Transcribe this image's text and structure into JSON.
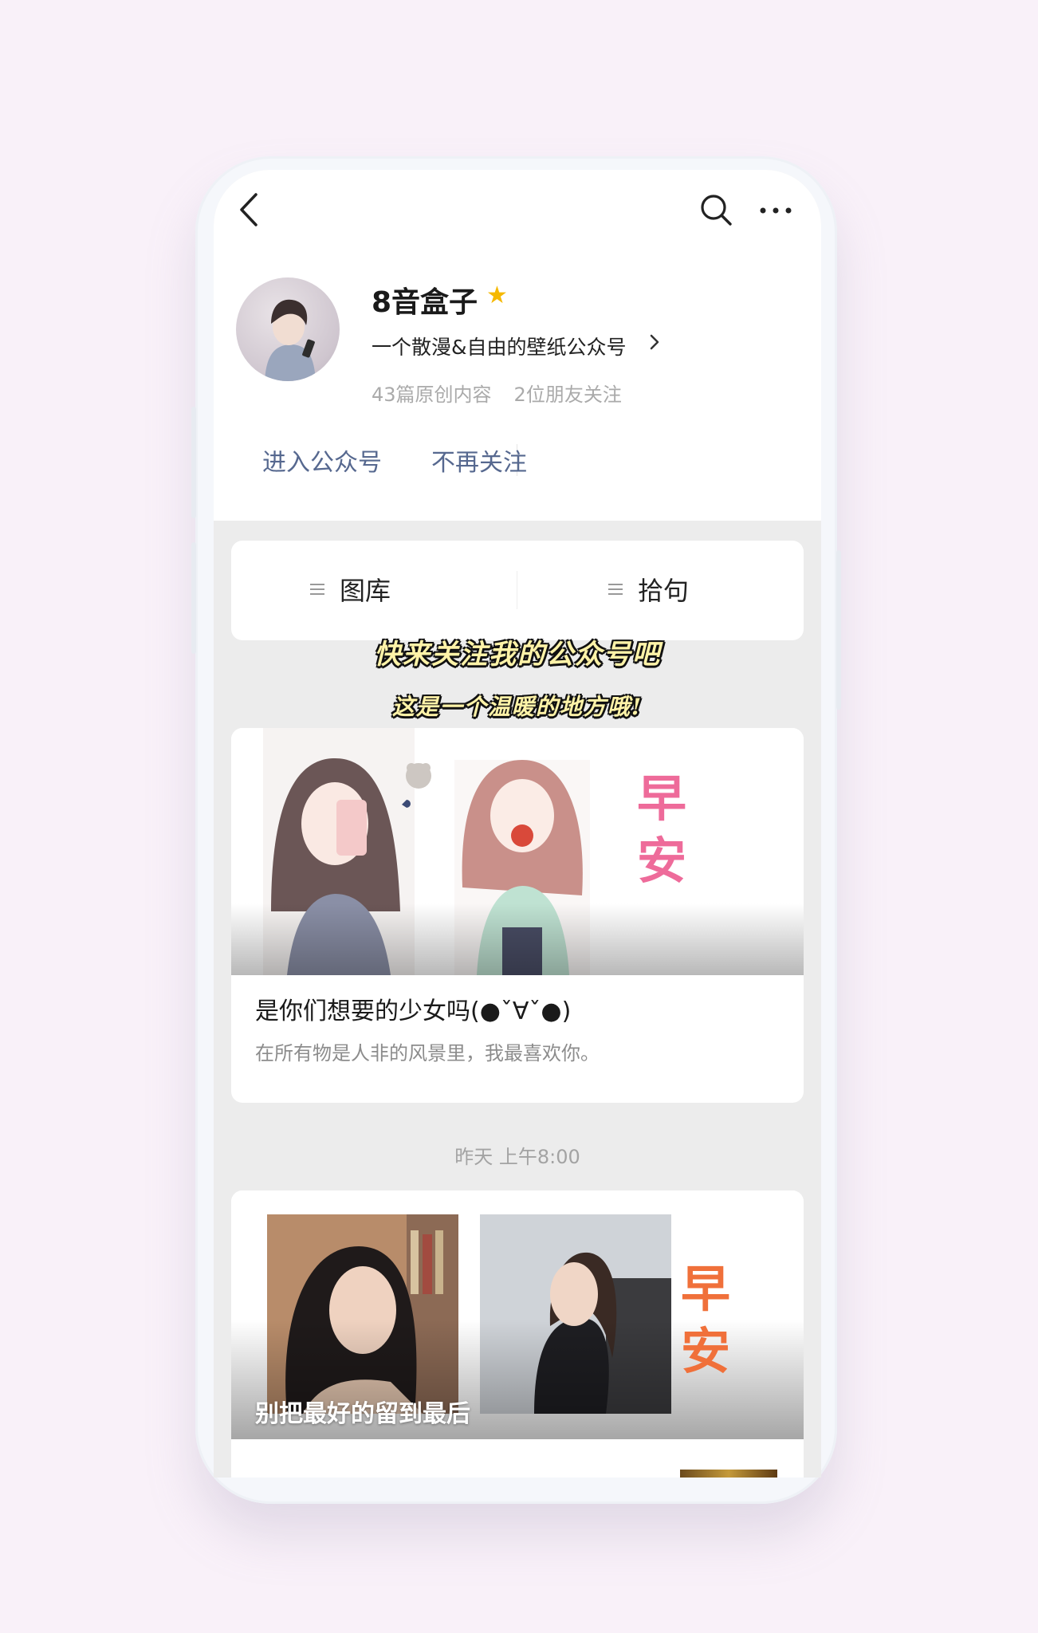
{
  "account": {
    "name": "8音盒子",
    "description": "一个散漫&自由的壁纸公众号",
    "stats": [
      "43篇原创内容",
      "2位朋友关注"
    ],
    "star_color": "#f5b800"
  },
  "actions": {
    "enter": "进入公众号",
    "unfollow": "不再关注"
  },
  "menu": {
    "items": [
      {
        "label": "图库",
        "icon": "menu-lines-icon"
      },
      {
        "label": "拾句",
        "icon": "menu-lines-icon"
      }
    ]
  },
  "overlay": {
    "line1": "快来关注我的公众号吧",
    "line2": "这是一个温暖的地方哦!"
  },
  "articles": [
    {
      "title": "是你们想要的少女吗(●ˇ∀ˇ●)",
      "subtitle": "在所有物是人非的风景里，我最喜欢你。",
      "stamp": "早安",
      "stamp_color": "#ee6b9a"
    },
    {
      "title": "别把最好的留到最后",
      "stamp": "早安",
      "stamp_color": "#f0703a"
    }
  ],
  "timestamp": "昨天 上午8:00",
  "colors": {
    "link": "#56688f",
    "page_bg": "#f9f1f9",
    "feed_bg": "#ececec"
  }
}
